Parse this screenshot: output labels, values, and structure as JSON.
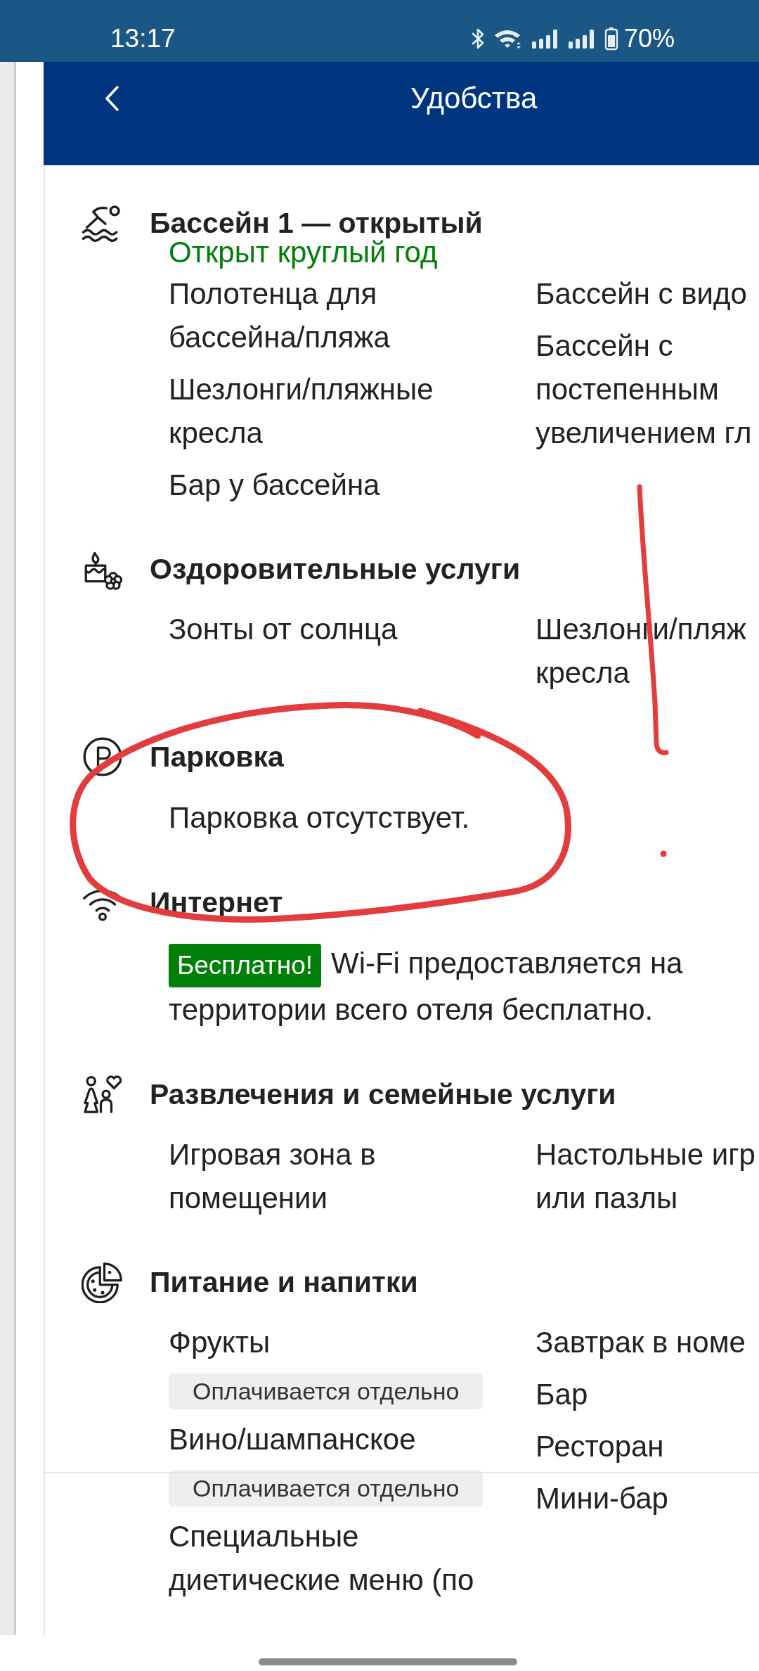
{
  "status_bar": {
    "time": "13:17",
    "battery": "70%"
  },
  "header": {
    "title": "Удобства"
  },
  "sections": [
    {
      "title": "Бассейн 1 — открытый",
      "note": "Открыт круглый год",
      "columns": [
        [
          {
            "name": "Полотенца для бассейна/пляжа"
          },
          {
            "name": "Шезлонги/пляжные кресла"
          },
          {
            "name": "Бар у бассейна"
          }
        ],
        [
          {
            "name": "Бассейн с видо"
          },
          {
            "name": "Бассейн с постепенным увеличением гл"
          }
        ]
      ]
    },
    {
      "title": "Оздоровительные услуги",
      "columns": [
        [
          {
            "name": "Зонты от солнца"
          }
        ],
        [
          {
            "name": "Шезлонги/пляж кресла"
          }
        ]
      ]
    },
    {
      "title": "Парковка",
      "text": "Парковка отсутствует."
    },
    {
      "title": "Интернет",
      "badge": "Бесплатно!",
      "text": "Wi-Fi предоставляется на территории всего отеля бесплатно."
    },
    {
      "title": "Развлечения и семейные услуги",
      "columns": [
        [
          {
            "name": "Игровая зона в помещении"
          }
        ],
        [
          {
            "name": "Настольные игр или пазлы"
          }
        ]
      ]
    },
    {
      "title": "Питание и напитки",
      "columns": [
        [
          {
            "name": "Фрукты",
            "fee": "Оплачивается отдельно"
          },
          {
            "name": "Вино/шампанское",
            "fee": "Оплачивается отдельно"
          },
          {
            "name": "Специальные диетические меню (по"
          }
        ],
        [
          {
            "name": "Завтрак в номе"
          },
          {
            "name": "Бар"
          },
          {
            "name": "Ресторан"
          },
          {
            "name": "Мини-бар"
          }
        ]
      ]
    }
  ],
  "annotations": [
    {
      "kind": "circle"
    },
    {
      "kind": "line"
    },
    {
      "kind": "dot"
    }
  ]
}
